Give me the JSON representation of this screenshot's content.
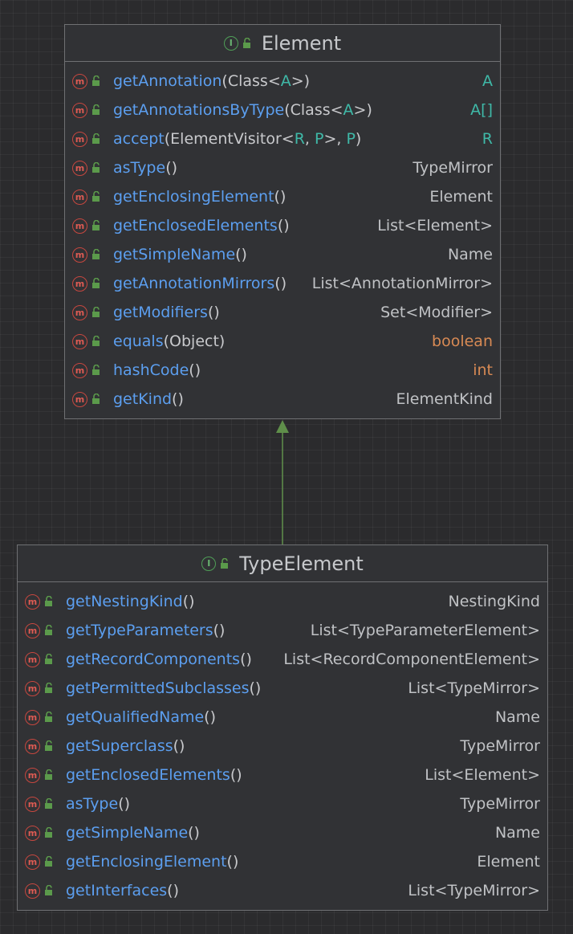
{
  "diagram": {
    "element": {
      "name": "Element",
      "members": [
        {
          "name": "getAnnotation",
          "params": [
            {
              "t": "(",
              "k": "pun"
            },
            {
              "t": "Class<",
              "k": "pt"
            },
            {
              "t": "A",
              "k": "tp"
            },
            {
              "t": ">)",
              "k": "pt"
            }
          ],
          "ret": "A",
          "ret_kind": "tp"
        },
        {
          "name": "getAnnotationsByType",
          "params": [
            {
              "t": "(",
              "k": "pun"
            },
            {
              "t": "Class<",
              "k": "pt"
            },
            {
              "t": "A",
              "k": "tp"
            },
            {
              "t": ">)",
              "k": "pt"
            }
          ],
          "ret": "A[]",
          "ret_kind": "tp"
        },
        {
          "name": "accept",
          "params": [
            {
              "t": "(",
              "k": "pun"
            },
            {
              "t": "ElementVisitor<",
              "k": "pt"
            },
            {
              "t": "R",
              "k": "tp"
            },
            {
              "t": ", ",
              "k": "pt"
            },
            {
              "t": "P",
              "k": "tp"
            },
            {
              "t": ">, ",
              "k": "pt"
            },
            {
              "t": "P",
              "k": "tp"
            },
            {
              "t": ")",
              "k": "pt"
            }
          ],
          "ret": "R",
          "ret_kind": "tp"
        },
        {
          "name": "asType",
          "params": [
            {
              "t": "()",
              "k": "pun"
            }
          ],
          "ret": "TypeMirror",
          "ret_kind": "plain"
        },
        {
          "name": "getEnclosingElement",
          "params": [
            {
              "t": "()",
              "k": "pun"
            }
          ],
          "ret": "Element",
          "ret_kind": "plain"
        },
        {
          "name": "getEnclosedElements",
          "params": [
            {
              "t": "()",
              "k": "pun"
            }
          ],
          "ret": "List<Element>",
          "ret_kind": "plain"
        },
        {
          "name": "getSimpleName",
          "params": [
            {
              "t": "()",
              "k": "pun"
            }
          ],
          "ret": "Name",
          "ret_kind": "plain"
        },
        {
          "name": "getAnnotationMirrors",
          "params": [
            {
              "t": "()",
              "k": "pun"
            }
          ],
          "ret": "List<AnnotationMirror>",
          "ret_kind": "plain"
        },
        {
          "name": "getModifiers",
          "params": [
            {
              "t": "()",
              "k": "pun"
            }
          ],
          "ret": "Set<Modifier>",
          "ret_kind": "plain"
        },
        {
          "name": "equals",
          "params": [
            {
              "t": "(Object)",
              "k": "pt"
            }
          ],
          "ret": "boolean",
          "ret_kind": "kw"
        },
        {
          "name": "hashCode",
          "params": [
            {
              "t": "()",
              "k": "pun"
            }
          ],
          "ret": "int",
          "ret_kind": "kw"
        },
        {
          "name": "getKind",
          "params": [
            {
              "t": "()",
              "k": "pun"
            }
          ],
          "ret": "ElementKind",
          "ret_kind": "plain"
        }
      ]
    },
    "type_element": {
      "name": "TypeElement",
      "members": [
        {
          "name": "getNestingKind",
          "params": [
            {
              "t": "()",
              "k": "pun"
            }
          ],
          "ret": "NestingKind",
          "ret_kind": "plain"
        },
        {
          "name": "getTypeParameters",
          "params": [
            {
              "t": "()",
              "k": "pun"
            }
          ],
          "ret": "List<TypeParameterElement>",
          "ret_kind": "plain"
        },
        {
          "name": "getRecordComponents",
          "params": [
            {
              "t": "()",
              "k": "pun"
            }
          ],
          "ret": "List<RecordComponentElement>",
          "ret_kind": "plain"
        },
        {
          "name": "getPermittedSubclasses",
          "params": [
            {
              "t": "()",
              "k": "pun"
            }
          ],
          "ret": "List<TypeMirror>",
          "ret_kind": "plain"
        },
        {
          "name": "getQualifiedName",
          "params": [
            {
              "t": "()",
              "k": "pun"
            }
          ],
          "ret": "Name",
          "ret_kind": "plain"
        },
        {
          "name": "getSuperclass",
          "params": [
            {
              "t": "()",
              "k": "pun"
            }
          ],
          "ret": "TypeMirror",
          "ret_kind": "plain"
        },
        {
          "name": "getEnclosedElements",
          "params": [
            {
              "t": "()",
              "k": "pun"
            }
          ],
          "ret": "List<Element>",
          "ret_kind": "plain"
        },
        {
          "name": "asType",
          "params": [
            {
              "t": "()",
              "k": "pun"
            }
          ],
          "ret": "TypeMirror",
          "ret_kind": "plain"
        },
        {
          "name": "getSimpleName",
          "params": [
            {
              "t": "()",
              "k": "pun"
            }
          ],
          "ret": "Name",
          "ret_kind": "plain"
        },
        {
          "name": "getEnclosingElement",
          "params": [
            {
              "t": "()",
              "k": "pun"
            }
          ],
          "ret": "Element",
          "ret_kind": "plain"
        },
        {
          "name": "getInterfaces",
          "params": [
            {
              "t": "()",
              "k": "pun"
            }
          ],
          "ret": "List<TypeMirror>",
          "ret_kind": "plain"
        }
      ]
    },
    "relation": {
      "from": "TypeElement",
      "to": "Element",
      "kind": "extends"
    },
    "icons": {
      "interface": "I",
      "method": "m"
    },
    "colors": {
      "background": "#2b2b2d",
      "node": "#313235",
      "border": "#6f7073",
      "method_name": "#5c9ff0",
      "type_param": "#3fb9a8",
      "keyword": "#d88a54",
      "method_icon": "#dd5b53",
      "interface_icon": "#69b372",
      "arrow": "#5f8f4a"
    }
  }
}
